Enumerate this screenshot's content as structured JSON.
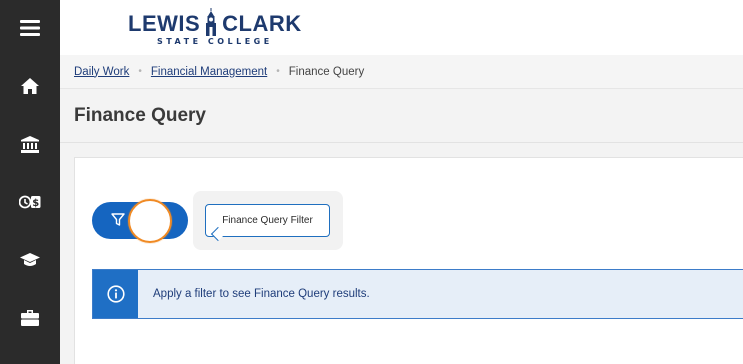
{
  "app": {
    "logo": {
      "main_left": "LEWIS",
      "main_right": "CLARK",
      "sub": "STATE COLLEGE"
    }
  },
  "rail": {
    "items": [
      {
        "icon": "hamburger-menu-icon"
      },
      {
        "icon": "home-icon"
      },
      {
        "icon": "bank-icon"
      },
      {
        "icon": "finance-icon"
      },
      {
        "icon": "graduation-cap-icon"
      },
      {
        "icon": "briefcase-icon"
      }
    ],
    "colors": {
      "background": "#2b2b2b",
      "icon": "#ffffff"
    }
  },
  "breadcrumb": {
    "items": [
      "Daily Work",
      "Financial Management"
    ],
    "current": "Finance Query",
    "separator": "•"
  },
  "page": {
    "title": "Finance Query"
  },
  "filter": {
    "button_icon": "filter-icon",
    "tooltip": "Finance Query Filter",
    "accent": "#1565c0"
  },
  "alert": {
    "icon": "info-icon",
    "message": "Apply a filter to see Finance Query results."
  }
}
